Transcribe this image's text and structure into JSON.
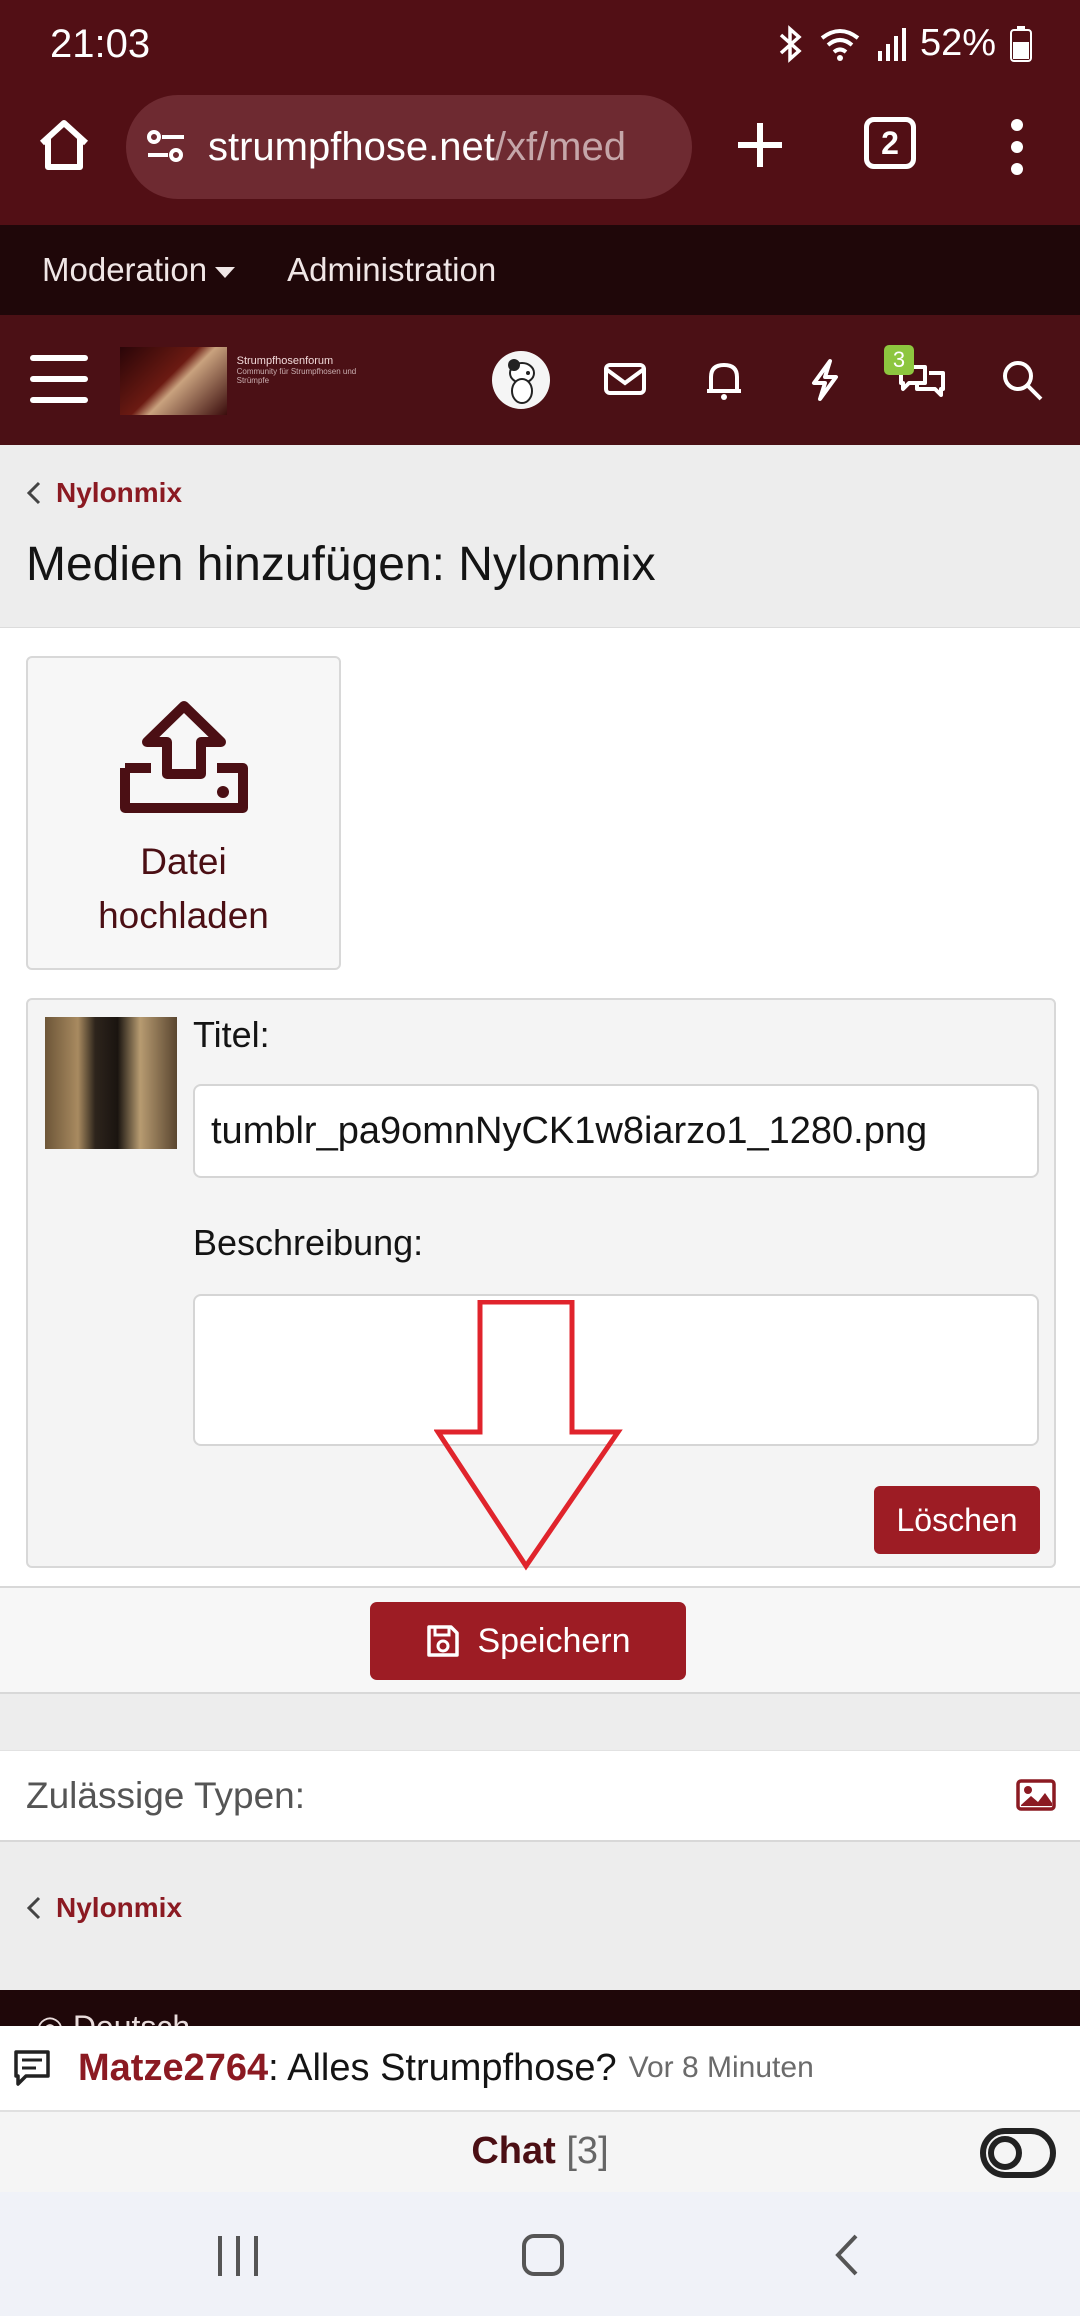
{
  "status": {
    "time": "21:03",
    "battery": "52%"
  },
  "browser": {
    "url_host": "strumpfhose.net",
    "url_path": "/xf/med",
    "tab_count": "2"
  },
  "modbar": {
    "moderation": "Moderation",
    "administration": "Administration"
  },
  "site": {
    "logo_title": "Strumpfhosenforum",
    "logo_subtitle": "Community für Strumpfhosen und Strümpfe",
    "conversations_badge": "3"
  },
  "breadcrumb": {
    "parent": "Nylonmix"
  },
  "page": {
    "title": "Medien hinzufügen: Nylonmix"
  },
  "upload": {
    "label_line1": "Datei",
    "label_line2": "hochladen"
  },
  "media_item": {
    "title_label": "Titel:",
    "title_value": "tumblr_pa9omnNyCK1w8iarzo1_1280.png",
    "description_label": "Beschreibung:",
    "description_value": "",
    "delete_label": "Löschen"
  },
  "actions": {
    "save_label": "Speichern"
  },
  "allowed_types": {
    "label": "Zulässige Typen:"
  },
  "footer": {
    "breadcrumb": "Nylonmix",
    "language": "Deutsch"
  },
  "chat": {
    "username": "Matze2764",
    "message": ": Alles Strumpfhose?",
    "time": "Vor 8 Minuten",
    "title": "Chat",
    "count": "[3]"
  },
  "colors": {
    "brand_dark": "#520f15",
    "header": "#4b1015",
    "accent_button": "#9d1c24",
    "link": "#8b1a22",
    "annotation_arrow": "#e0242c"
  }
}
